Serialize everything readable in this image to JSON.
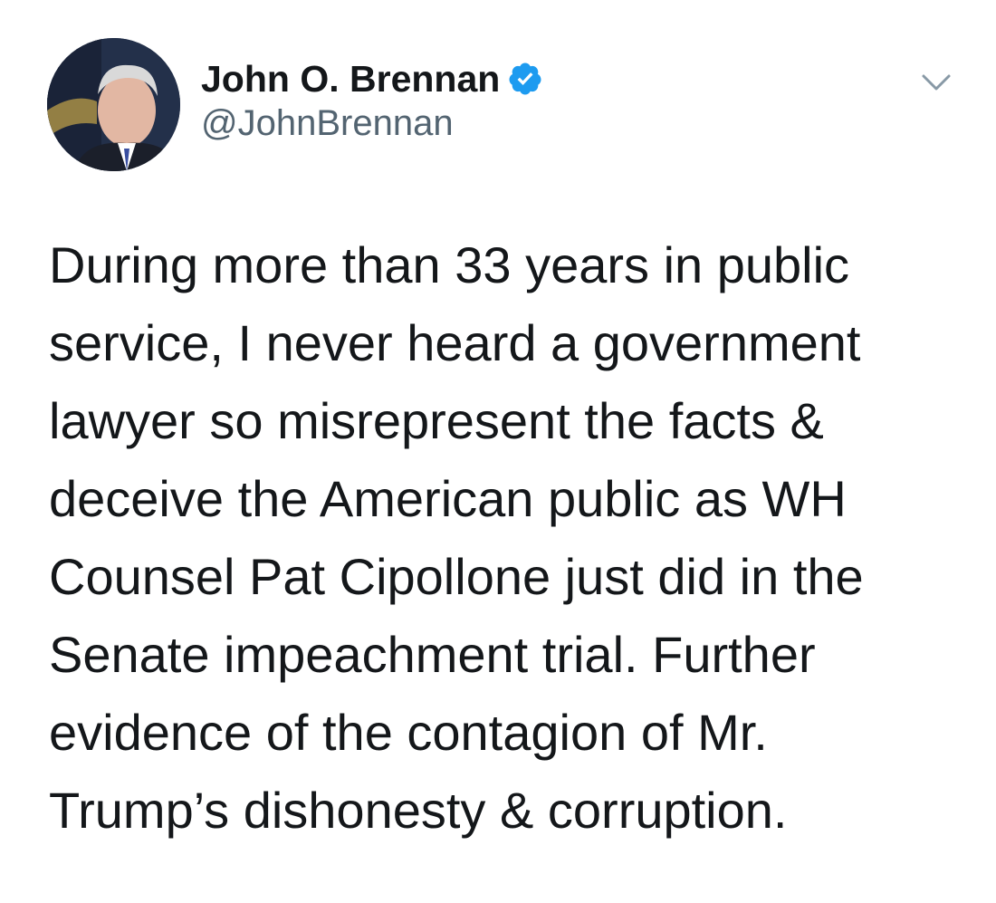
{
  "tweet": {
    "author": {
      "name": "John O. Brennan",
      "handle": "@JohnBrennan",
      "verified": true,
      "avatar_icon": "profile-photo"
    },
    "menu_icon": "chevron-down-icon",
    "text_lines": [
      "During more than 33 years in public",
      "service, I never heard a government",
      "lawyer so misrepresent the facts &",
      "deceive the American public as WH",
      "Counsel Pat Cipollone just did in the",
      "Senate impeachment trial. Further",
      "evidence of the contagion of Mr.",
      "Trump’s dishonesty & corruption."
    ]
  },
  "colors": {
    "verified_badge": "#1d9bf0",
    "primary_text": "#14171a",
    "secondary_text": "#536471",
    "chevron": "#8899a6",
    "background": "#ffffff"
  }
}
